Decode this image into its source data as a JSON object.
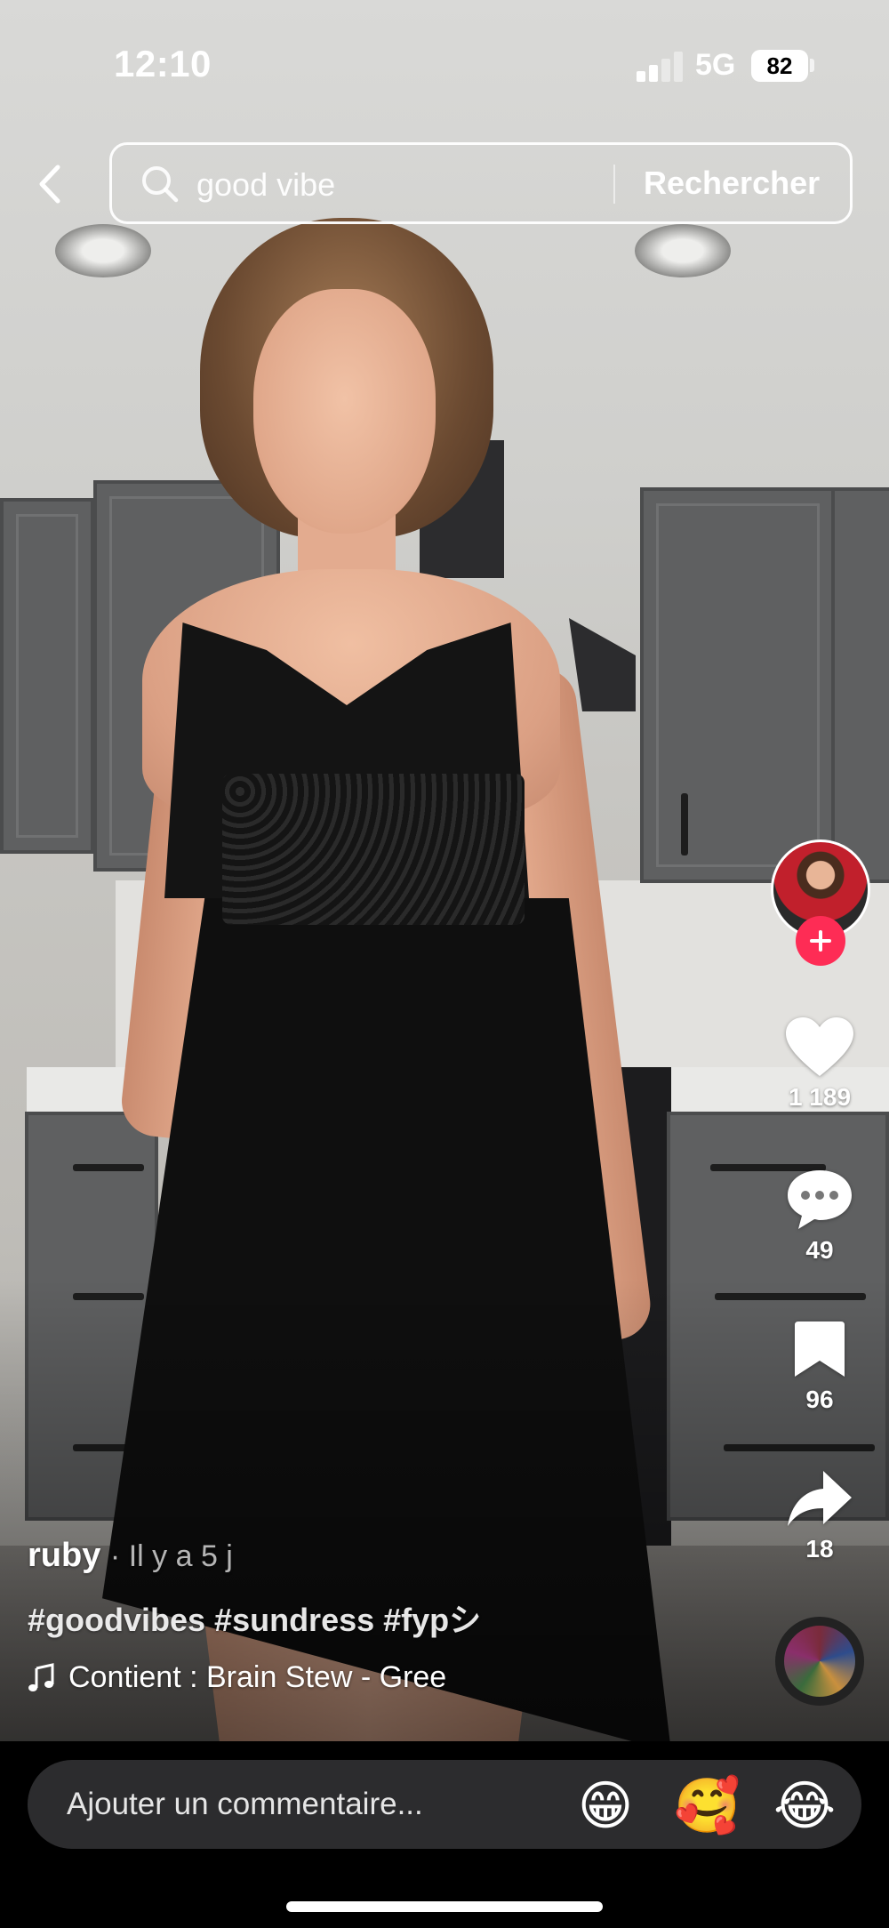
{
  "status_bar": {
    "time": "12:10",
    "network": "5G",
    "battery": "82"
  },
  "search": {
    "query": "good vibe",
    "button_label": "Rechercher"
  },
  "actions": {
    "likes": "1 189",
    "comments": "49",
    "saves": "96",
    "shares": "18"
  },
  "post": {
    "author": "ruby",
    "posted": "· Il y a 5 j",
    "hashtags": "#goodvibes #sundress #fypシ",
    "music": "Contient : Brain Stew - Gree"
  },
  "comment_bar": {
    "placeholder": "Ajouter un commentaire...",
    "emojis": [
      "😁",
      "🥰",
      "😂"
    ]
  },
  "colors": {
    "accent": "#fe2c55",
    "input_bg": "#2c2c2e"
  },
  "icons": [
    "back-icon",
    "search-icon",
    "plus-icon",
    "heart-icon",
    "comment-icon",
    "bookmark-icon",
    "share-icon",
    "music-note-icon"
  ]
}
